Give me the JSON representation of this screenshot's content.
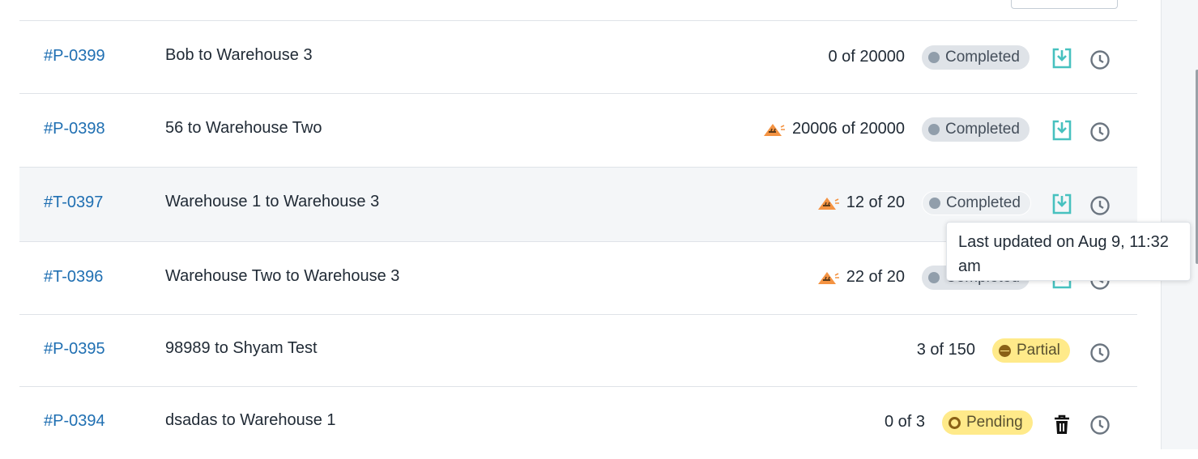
{
  "tooltip": {
    "text": "Last updated on Aug 9, 11:32 am"
  },
  "rows": [
    {
      "id": "#P-0399",
      "description": "Bob to Warehouse 3",
      "quantity": "0 of 20000",
      "warning": false,
      "status": "Completed",
      "status_type": "completed",
      "action": "download-icon"
    },
    {
      "id": "#P-0398",
      "description": "56 to Warehouse Two",
      "quantity": "20006 of 20000",
      "warning": true,
      "status": "Completed",
      "status_type": "completed",
      "action": "download-icon"
    },
    {
      "id": "#T-0397",
      "description": "Warehouse 1 to Warehouse 3",
      "quantity": "12 of 20",
      "warning": true,
      "status": "Completed",
      "status_type": "completed",
      "action": "download-icon"
    },
    {
      "id": "#T-0396",
      "description": "Warehouse Two to Warehouse 3",
      "quantity": "22 of 20",
      "warning": true,
      "status": "Completed",
      "status_type": "completed",
      "action": "download-icon"
    },
    {
      "id": "#P-0395",
      "description": "98989 to Shyam Test",
      "quantity": "3 of 150",
      "warning": false,
      "status": "Partial",
      "status_type": "partial",
      "action": "none"
    },
    {
      "id": "#P-0394",
      "description": "dsadas to Warehouse 1",
      "quantity": "0 of 3",
      "warning": false,
      "status": "Pending",
      "status_type": "pending",
      "action": "trash-icon"
    }
  ],
  "colors": {
    "link": "#1f6fb2",
    "download_icon": "#47c1bf",
    "warning_icon": "#f49342",
    "completed_badge": "#dfe3e8",
    "pending_badge": "#ffea8a"
  }
}
